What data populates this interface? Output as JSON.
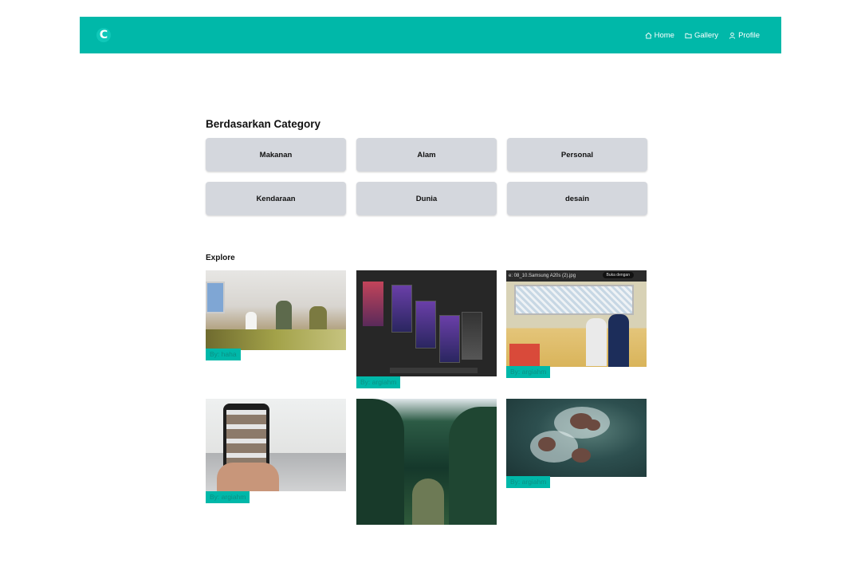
{
  "navbar": {
    "logo_letter": "C",
    "links": [
      {
        "label": "Home",
        "icon": "home-icon"
      },
      {
        "label": "Gallery",
        "icon": "folder-icon"
      },
      {
        "label": "Profile",
        "icon": "user-icon"
      }
    ]
  },
  "category_section": {
    "title": "Berdasarkan Category",
    "categories": [
      "Makanan",
      "Alam",
      "Personal",
      "Kendaraan",
      "Dunia",
      "desain"
    ]
  },
  "explore_section": {
    "title": "Explore",
    "cards": [
      {
        "by": "By: haha"
      },
      {
        "by": "By: argiahm"
      },
      {
        "by": "By: argiahm",
        "image_caption": "e: 08_10.Samsung A20s (2).jpg",
        "image_button": "Buka dengan"
      },
      {
        "by": "By: argiahm"
      },
      {
        "by": ""
      },
      {
        "by": "By: argiahm"
      }
    ]
  },
  "colors": {
    "accent": "#00b8a9",
    "category_button": "#d4d7dd"
  }
}
